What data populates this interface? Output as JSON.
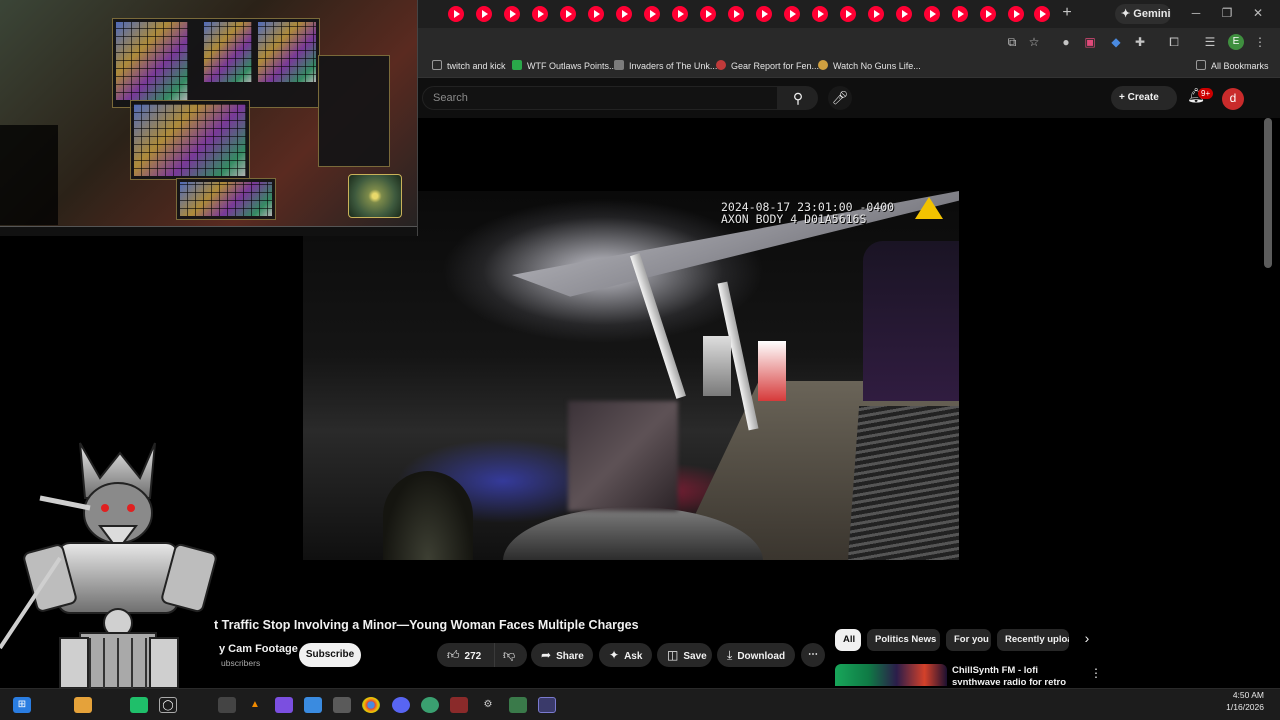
{
  "browser": {
    "gemini_label": "Gemini",
    "bookmarks": [
      {
        "label": "twitch and kick",
        "color": "#8a8a8a"
      },
      {
        "label": "WTF Outlaws Points...",
        "color": "#2aa84a"
      },
      {
        "label": "Invaders of The Unk...",
        "color": "#7b7b7b"
      },
      {
        "label": "Gear Report for Fen...",
        "color": "#c03a3a"
      },
      {
        "label": "Watch No Guns Life...",
        "color": "#d0a040"
      }
    ],
    "all_bookmarks_label": "All Bookmarks",
    "profile_initial": "E"
  },
  "youtube": {
    "search_placeholder": "Search",
    "create_label": "Create",
    "notification_badge": "9+",
    "avatar_initial": "d",
    "video": {
      "overlay_line1": "2024-08-17 23:01:00 -0400",
      "overlay_line2": "AXON BODY 4 D01A5616S",
      "title": "t Traffic Stop Involving a Minor—Young Woman Faces Multiple Charges",
      "channel": "y Cam Footage",
      "subscribers": "ubscribers",
      "subscribe_label": "Subscribe",
      "likes": "272",
      "share_label": "Share",
      "ask_label": "Ask",
      "save_label": "Save",
      "download_label": "Download"
    },
    "chips": [
      "All",
      "Politics News",
      "For you",
      "Recently uploa"
    ],
    "recommendation": {
      "title": "ChillSynth FM - lofi synthwave radio for retro dreaming"
    }
  },
  "taskbar": {
    "time": "4:50 AM",
    "date": "1/16/2026"
  },
  "colors": {
    "youtube_red": "#ff0033",
    "background": "#0f0f0f",
    "notification_red": "#cc0000"
  }
}
